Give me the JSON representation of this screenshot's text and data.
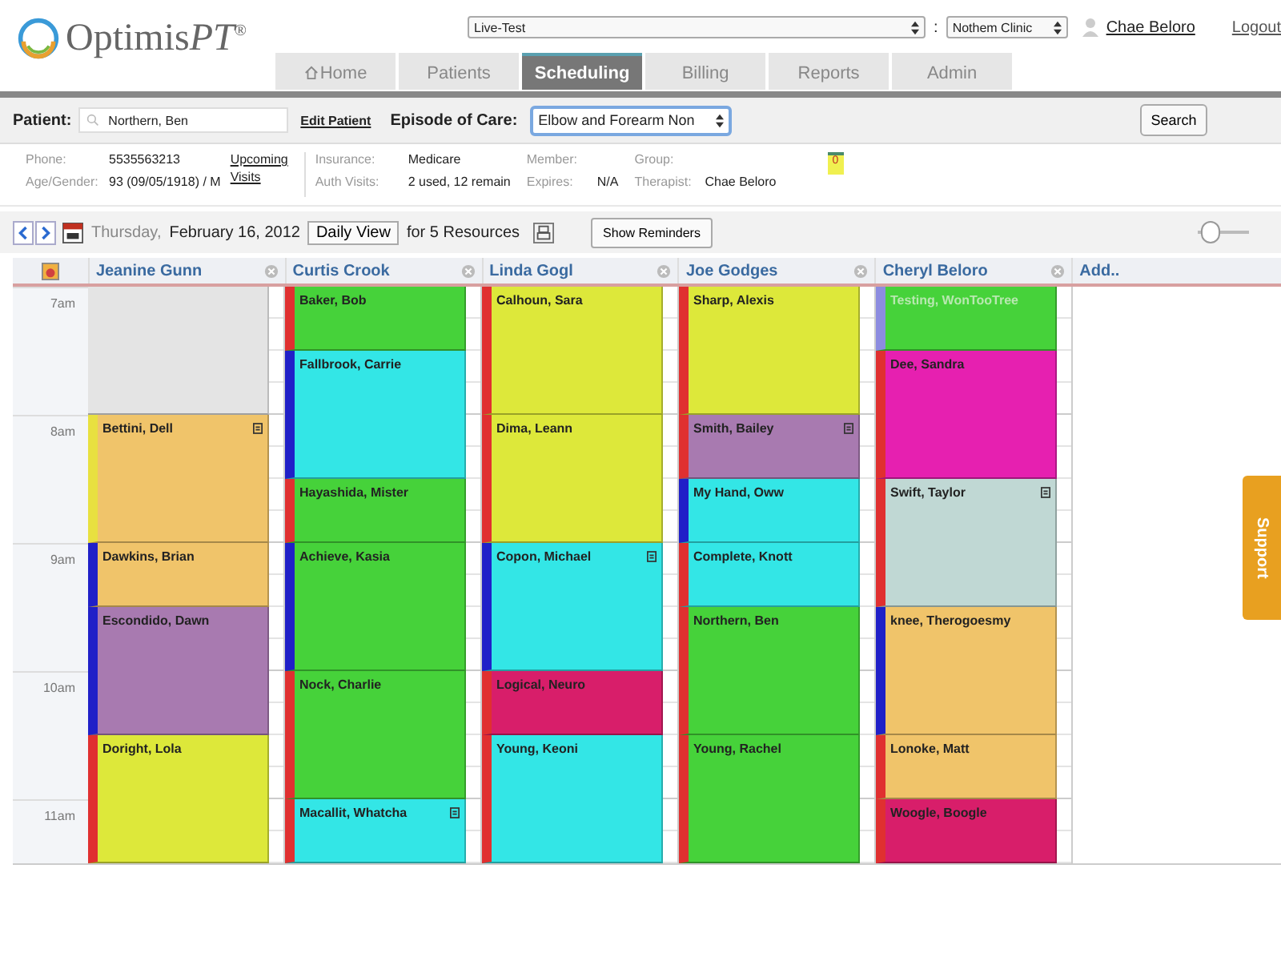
{
  "header": {
    "logo": "Optimis",
    "logo_accent": "PT",
    "logo_mark": "®",
    "environment": "Live-Test",
    "separator": ":",
    "clinic": "Nothem Clinic",
    "user": "Chae Beloro",
    "logout": "Logout"
  },
  "tabs": [
    {
      "label": "Home",
      "selected": false
    },
    {
      "label": "Patients",
      "selected": false
    },
    {
      "label": "Scheduling",
      "selected": true
    },
    {
      "label": "Billing",
      "selected": false
    },
    {
      "label": "Reports",
      "selected": false
    },
    {
      "label": "Admin",
      "selected": false
    }
  ],
  "patient_bar": {
    "label": "Patient:",
    "patient": "Northern, Ben",
    "edit_link": "Edit Patient",
    "episode_label": "Episode of Care:",
    "episode": "Elbow and Forearm Non",
    "search_button": "Search"
  },
  "patient_info": {
    "phone_label": "Phone:",
    "phone": "5535563213",
    "age_label": "Age/Gender:",
    "age": "93 (09/05/1918) / M",
    "upcoming_link": "Upcoming",
    "visits_link": "Visits",
    "insurance_label": "Insurance:",
    "insurance": "Medicare",
    "auth_label": "Auth Visits:",
    "auth": "2 used, 12 remain",
    "member_label": "Member:",
    "expires_label": "Expires:",
    "expires": "N/A",
    "group_label": "Group:",
    "therapist_label": "Therapist:",
    "therapist": "Chae Beloro",
    "reminder_count": "0"
  },
  "toolbar": {
    "weekday": "Thursday,",
    "date": "February 16, 2012",
    "view_button": "Daily View",
    "resources": "for 5 Resources",
    "reminders_button": "Show Reminders",
    "zoom_slider": {
      "level": 0.1
    }
  },
  "hours": [
    "7am",
    "8am",
    "9am",
    "10am",
    "11am"
  ],
  "add_column": "Add..",
  "support_tab": "Support",
  "resources": [
    {
      "name": "Jeanine Gunn",
      "appointments": [
        {
          "kind": "blocked",
          "long": true,
          "color": "#e4e4e4"
        },
        {
          "kind": "visit",
          "name": "Bettini, Dell",
          "long": true,
          "color": "#f0c46a",
          "arrived": false,
          "pending": true,
          "note": true,
          "dimmed": false
        },
        {
          "kind": "visit",
          "name": "Dawkins, Brian",
          "long": false,
          "color": "#f0c46a",
          "arrived": true,
          "pending": false,
          "note": false,
          "dimmed": false
        },
        {
          "kind": "visit",
          "name": "Escondido, Dawn",
          "long": true,
          "color": "#a87ab0",
          "arrived": true,
          "pending": false,
          "note": false,
          "dimmed": false
        },
        {
          "kind": "visit",
          "name": "Doright, Lola",
          "long": true,
          "color": "#dde83a",
          "arrived": false,
          "pending": false,
          "note": false,
          "dimmed": false
        }
      ]
    },
    {
      "name": "Curtis Crook",
      "appointments": [
        {
          "kind": "visit",
          "name": "Baker, Bob",
          "long": false,
          "color": "#46d23a",
          "arrived": false,
          "pending": false,
          "note": false,
          "dimmed": false
        },
        {
          "kind": "visit",
          "name": "Fallbrook, Carrie",
          "long": true,
          "color": "#33e6e6",
          "arrived": true,
          "pending": false,
          "note": false,
          "dimmed": false
        },
        {
          "kind": "visit",
          "name": "Hayashida, Mister",
          "long": false,
          "color": "#46d23a",
          "arrived": false,
          "pending": false,
          "note": false,
          "dimmed": false
        },
        {
          "kind": "visit",
          "name": "Achieve, Kasia",
          "long": true,
          "color": "#46d23a",
          "arrived": true,
          "pending": false,
          "note": false,
          "dimmed": false
        },
        {
          "kind": "visit",
          "name": "Nock, Charlie",
          "long": true,
          "color": "#46d23a",
          "arrived": false,
          "pending": false,
          "note": false,
          "dimmed": false
        },
        {
          "kind": "visit",
          "name": "Macallit, Whatcha",
          "long": false,
          "color": "#33e6e6",
          "arrived": false,
          "pending": false,
          "note": true,
          "dimmed": false
        }
      ]
    },
    {
      "name": "Linda Gogl",
      "appointments": [
        {
          "kind": "visit",
          "name": "Calhoun, Sara",
          "long": true,
          "color": "#dde83a",
          "arrived": false,
          "pending": false,
          "note": false,
          "dimmed": false
        },
        {
          "kind": "visit",
          "name": "Dima, Leann",
          "long": true,
          "color": "#dde83a",
          "arrived": false,
          "pending": false,
          "note": false,
          "dimmed": false
        },
        {
          "kind": "visit",
          "name": "Copon, Michael",
          "long": true,
          "color": "#33e6e6",
          "arrived": true,
          "pending": false,
          "note": true,
          "dimmed": false
        },
        {
          "kind": "visit",
          "name": "Logical, Neuro",
          "long": false,
          "color": "#d81e6a",
          "arrived": false,
          "pending": false,
          "note": false,
          "dimmed": false
        },
        {
          "kind": "visit",
          "name": "Young, Keoni",
          "long": true,
          "color": "#33e6e6",
          "arrived": false,
          "pending": false,
          "note": false,
          "dimmed": false
        }
      ]
    },
    {
      "name": "Joe Godges",
      "appointments": [
        {
          "kind": "visit",
          "name": "Sharp, Alexis",
          "long": true,
          "color": "#dde83a",
          "arrived": false,
          "pending": false,
          "note": false,
          "dimmed": false
        },
        {
          "kind": "visit",
          "name": "Smith, Bailey",
          "long": false,
          "color": "#a87ab0",
          "arrived": false,
          "pending": false,
          "note": true,
          "dimmed": false
        },
        {
          "kind": "visit",
          "name": "My Hand, Oww",
          "long": false,
          "color": "#33e6e6",
          "arrived": true,
          "pending": false,
          "note": false,
          "dimmed": false
        },
        {
          "kind": "visit",
          "name": "Complete, Knott",
          "long": false,
          "color": "#33e6e6",
          "arrived": false,
          "pending": false,
          "note": false,
          "dimmed": false
        },
        {
          "kind": "visit",
          "name": "Northern, Ben",
          "long": true,
          "color": "#46d23a",
          "arrived": false,
          "pending": false,
          "note": false,
          "dimmed": false
        },
        {
          "kind": "visit",
          "name": "Young, Rachel",
          "long": true,
          "color": "#46d23a",
          "arrived": false,
          "pending": false,
          "note": false,
          "dimmed": false
        }
      ]
    },
    {
      "name": "Cheryl Beloro",
      "appointments": [
        {
          "kind": "visit",
          "name": "Testing, WonTooTree",
          "long": false,
          "color": "#46d23a",
          "arrived": false,
          "pending": false,
          "note": false,
          "dimmed": true
        },
        {
          "kind": "visit",
          "name": "Dee, Sandra",
          "long": true,
          "color": "#e620b0",
          "arrived": false,
          "pending": false,
          "note": false,
          "dimmed": false
        },
        {
          "kind": "visit",
          "name": "Swift, Taylor",
          "long": true,
          "color": "#c0d8d4",
          "arrived": false,
          "pending": false,
          "note": true,
          "dimmed": false
        },
        {
          "kind": "visit",
          "name": "knee, Therogoesmy",
          "long": true,
          "color": "#f0c46a",
          "arrived": true,
          "pending": false,
          "note": false,
          "dimmed": false
        },
        {
          "kind": "visit",
          "name": "Lonoke, Matt",
          "long": false,
          "color": "#f0c46a",
          "arrived": false,
          "pending": false,
          "note": false,
          "dimmed": false
        },
        {
          "kind": "visit",
          "name": "Woogle, Boogle",
          "long": false,
          "color": "#d81e6a",
          "arrived": false,
          "pending": false,
          "note": false,
          "dimmed": false
        }
      ]
    }
  ]
}
